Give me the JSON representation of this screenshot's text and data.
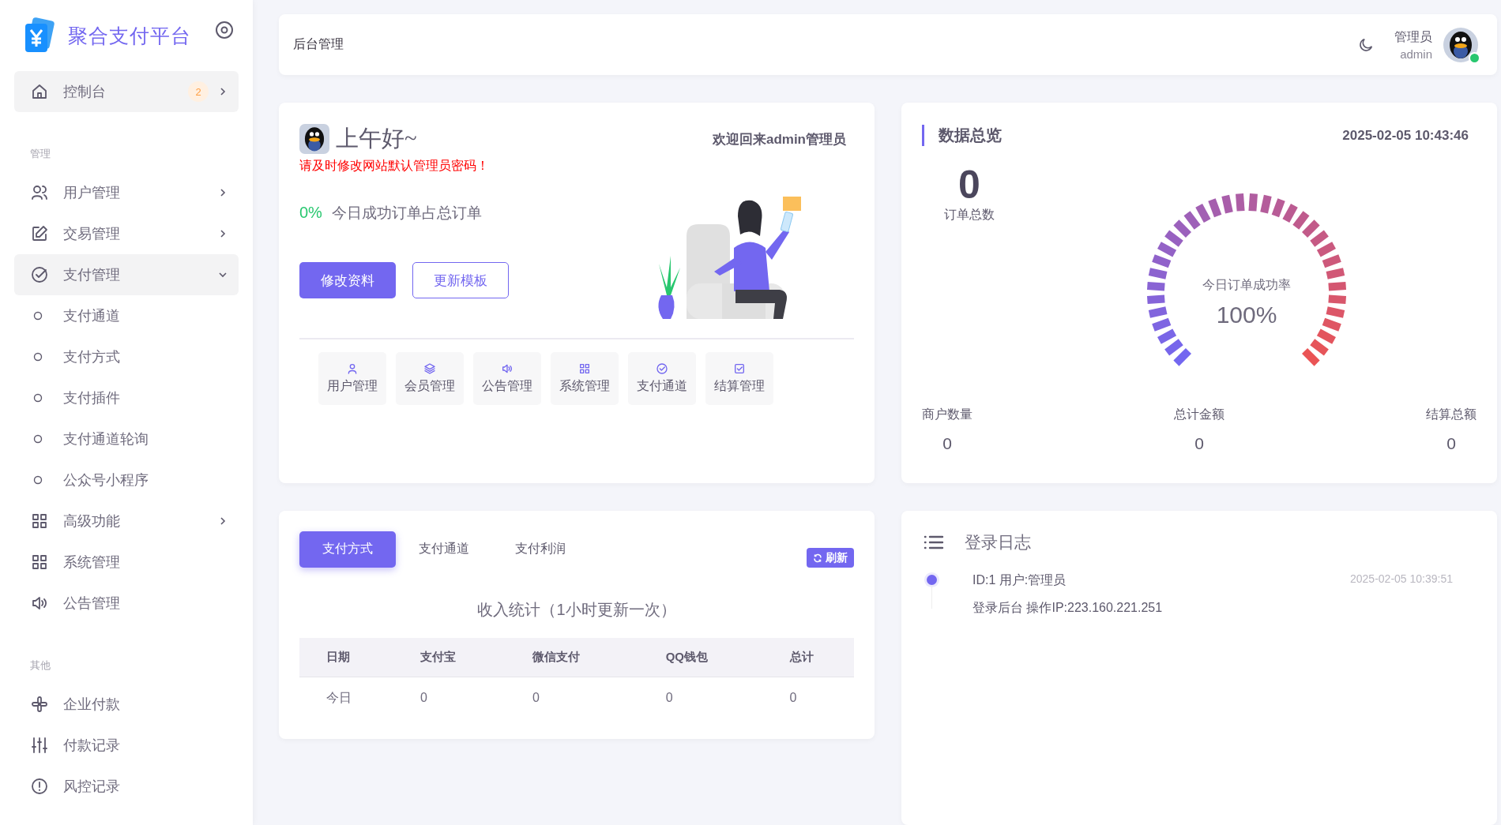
{
  "sidebar": {
    "brand": "聚合支付平台",
    "sections": [
      {
        "items": [
          {
            "label": "控制台",
            "kind": "group",
            "selected": true,
            "expanded": false,
            "badge": "2"
          }
        ]
      },
      {
        "heading": "管理",
        "items": [
          {
            "label": "用户管理",
            "kind": "group",
            "selected": false,
            "expanded": false
          },
          {
            "label": "交易管理",
            "kind": "group",
            "selected": false,
            "expanded": false
          },
          {
            "label": "支付管理",
            "kind": "group",
            "selected": true,
            "expanded": true,
            "children": [
              {
                "label": "支付通道",
                "selected": false
              },
              {
                "label": "支付方式",
                "selected": false
              },
              {
                "label": "支付插件",
                "selected": false
              },
              {
                "label": "支付通道轮询",
                "selected": false
              },
              {
                "label": "公众号小程序",
                "selected": false
              }
            ]
          },
          {
            "label": "高级功能",
            "kind": "group",
            "selected": false,
            "expanded": false
          },
          {
            "label": "系统管理",
            "kind": "link",
            "selected": false
          },
          {
            "label": "公告管理",
            "kind": "link",
            "selected": false
          }
        ]
      },
      {
        "heading": "其他",
        "items": [
          {
            "label": "企业付款",
            "kind": "link",
            "selected": false
          },
          {
            "label": "付款记录",
            "kind": "link",
            "selected": false
          },
          {
            "label": "风控记录",
            "kind": "link",
            "selected": false
          }
        ]
      }
    ]
  },
  "topbar": {
    "title": "后台管理",
    "user_name": "管理员",
    "user_id": "admin",
    "online": true
  },
  "welcome": {
    "greeting": "上午好~",
    "welcome_text": "欢迎回来admin管理员",
    "warning": "请及时修改网站默认管理员密码！",
    "rate": "0%",
    "rate_label": "今日成功订单占总订单",
    "buttons": [
      {
        "label": "修改资料",
        "kind": "primary"
      },
      {
        "label": "更新模板",
        "kind": "outline"
      }
    ],
    "shortcuts": [
      "用户管理",
      "会员管理",
      "公告管理",
      "系统管理",
      "支付通道",
      "结算管理"
    ]
  },
  "overview": {
    "title": "数据总览",
    "datetime": "2025-02-05 10:43:46",
    "order_total": "0",
    "order_total_label": "订单总数",
    "gauge_label": "今日订单成功率",
    "gauge_value": "100%",
    "stats": [
      {
        "label": "商户数量",
        "value": "0"
      },
      {
        "label": "总计金额",
        "value": "0"
      },
      {
        "label": "结算总额",
        "value": "0"
      }
    ]
  },
  "income": {
    "tabs": [
      {
        "label": "支付方式",
        "selected": true
      },
      {
        "label": "支付通道",
        "selected": false
      },
      {
        "label": "支付利润",
        "selected": false
      }
    ],
    "refresh": "刷新",
    "caption": "收入统计（1小时更新一次）",
    "table": {
      "columns": [
        "日期",
        "支付宝",
        "微信支付",
        "QQ钱包",
        "总计"
      ],
      "rows": [
        [
          "今日",
          "0",
          "0",
          "0",
          "0"
        ]
      ]
    }
  },
  "login_log": {
    "title": "登录日志",
    "entries": [
      {
        "title": "ID:1 用户:管理员",
        "time": "2025-02-05 10:39:51",
        "detail": "登录后台 操作IP:223.160.221.251"
      }
    ]
  }
}
